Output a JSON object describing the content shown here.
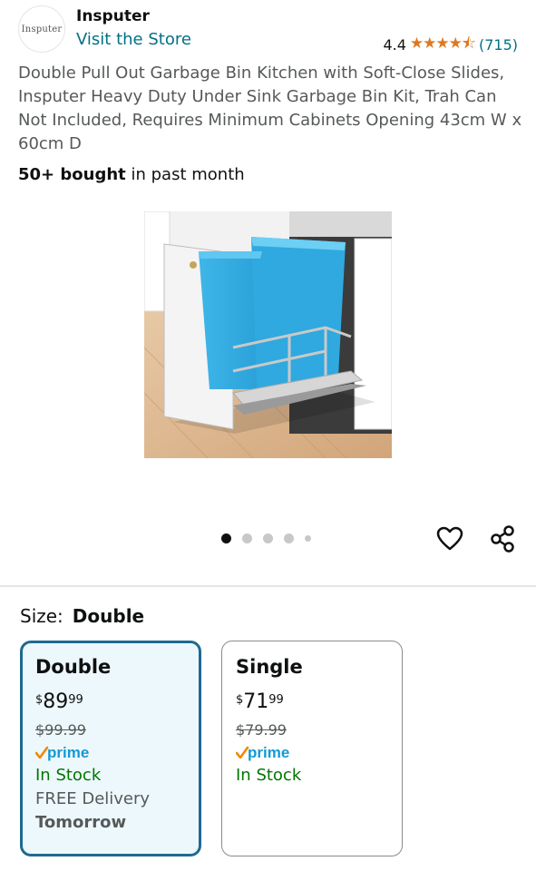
{
  "header": {
    "logo_text": "Insputer",
    "brand_name": "Insputer",
    "store_link": "Visit the Store",
    "rating_value": "4.4",
    "stars_display": "★★★★⯪",
    "rating_count": "(715)"
  },
  "product": {
    "title": "Double Pull Out Garbage Bin Kitchen with Soft-Close Slides, Insputer Heavy Duty Under Sink Garbage Bin Kit, Trah Can Not Included, Requires Minimum Cabinets Opening 43cm W x 60cm D",
    "bought_count": "50+ bought",
    "bought_suffix": " in past month",
    "image_alt": "Double pull-out garbage bin with two blue bins in a white cabinet frame"
  },
  "carousel": {
    "total_dots": 5,
    "active_index": 0
  },
  "actions": {
    "wishlist_icon": "heart-outline-icon",
    "share_icon": "share-icon"
  },
  "size": {
    "label": "Size:",
    "selected": "Double"
  },
  "options": [
    {
      "name": "Double",
      "currency": "$",
      "price_whole": "89",
      "price_fraction": "99",
      "list_price": "$99.99",
      "prime": "prime",
      "stock": "In Stock",
      "delivery": "FREE Delivery",
      "delivery_day": "Tomorrow"
    },
    {
      "name": "Single",
      "currency": "$",
      "price_whole": "71",
      "price_fraction": "99",
      "list_price": "$79.99",
      "prime": "prime",
      "stock": "In Stock"
    }
  ],
  "colors": {
    "link": "#007185",
    "star": "#de7921",
    "prime_blue": "#1399d5",
    "prime_check": "#f08804",
    "in_stock": "#007600",
    "selected_border": "#1e6a8f",
    "selected_bg": "#edf8fd"
  }
}
